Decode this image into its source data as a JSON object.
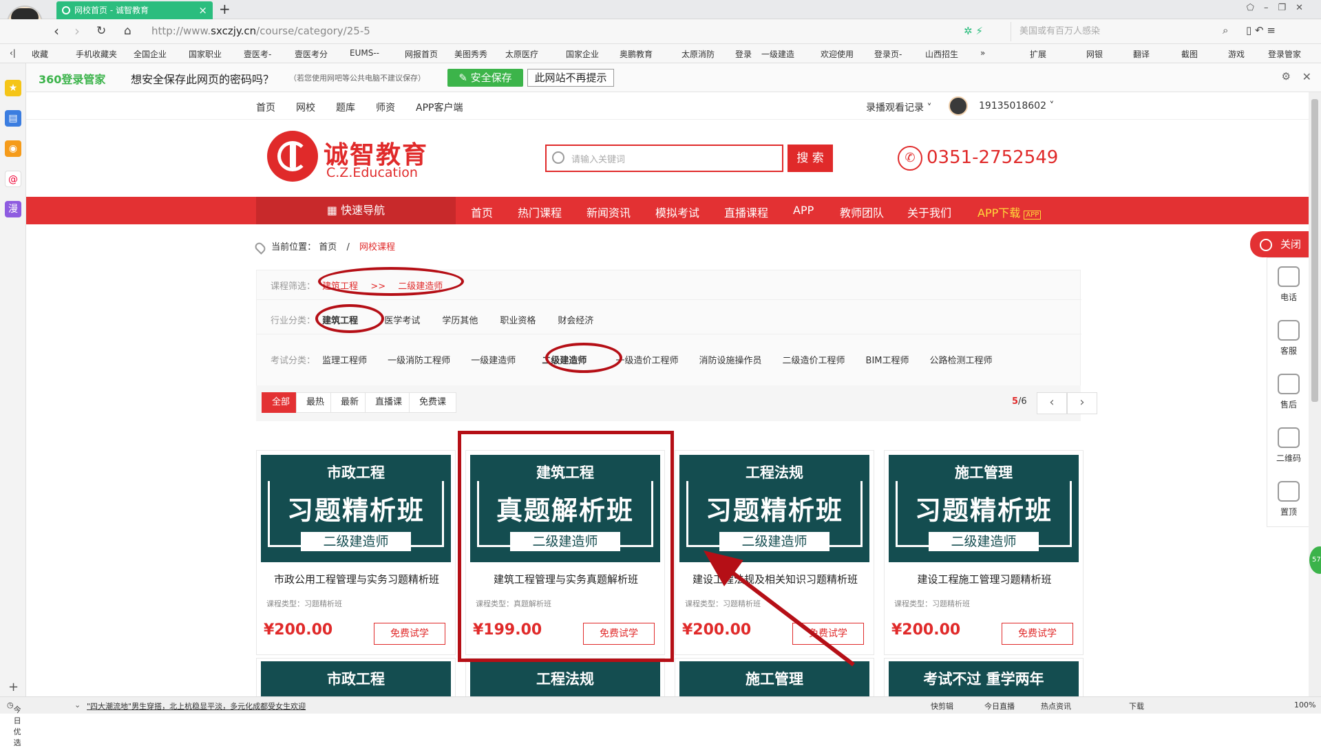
{
  "browser": {
    "tab_title": "网校首页 - 诚智教育",
    "new_tab": "+",
    "url_prefix": "http://www.",
    "url_domain": "sxczjy.cn",
    "url_path": "/course/category/25-5",
    "search_placeholder": "美国或有百万人感染",
    "bookmarks": [
      "收藏",
      "手机收藏夹",
      "全国企业",
      "国家职业",
      "壹医考-",
      "壹医考分",
      "EUMS--",
      "网报首页",
      "美图秀秀",
      "太原医疗",
      "国家企业",
      "奥鹏教育",
      "太原消防",
      "登录",
      "一级建造",
      "欢迎使用",
      "登录页-",
      "山西招生"
    ],
    "bookmarks_more": "»",
    "right_tools": [
      "扩展",
      "网银",
      "翻译",
      "截图",
      "游戏",
      "登录管家"
    ]
  },
  "password_bar": {
    "logo": "360登录管家",
    "question": "想安全保存此网页的密码吗？",
    "note": "（若您使用网吧等公共电脑不建议保存）",
    "save_label": "安全保存",
    "no_label": "此网站不再提示"
  },
  "site": {
    "topnav": [
      "首页",
      "网校",
      "题库",
      "师资",
      "APP客户端"
    ],
    "history": "录播观看记录",
    "username": "19135018602",
    "logo_text": "诚智教育",
    "logo_sub": "C.Z.Education",
    "search_placeholder": "请输入关键词",
    "search_btn": "搜 索",
    "phone": "0351-2752549",
    "quick_nav": "快速导航",
    "mainnav": [
      "首页",
      "热门课程",
      "新闻资讯",
      "模拟考试",
      "直播课程",
      "APP",
      "教师团队",
      "关于我们"
    ],
    "app_download": "APP下载",
    "breadcrumb": {
      "label": "当前位置：",
      "home": "首页",
      "sep": "/",
      "current": "网校课程"
    },
    "filter": {
      "course_label": "课程筛选：",
      "course_path_a": "建筑工程",
      "course_path_sep": ">>",
      "course_path_b": "二级建造师",
      "industry_label": "行业分类：",
      "industry_selected": "建筑工程",
      "industries": [
        "医学考试",
        "学历其他",
        "职业资格",
        "财会经济"
      ],
      "exam_label": "考试分类：",
      "exams_before": [
        "监理工程师",
        "一级消防工程师",
        "一级建造师"
      ],
      "exam_selected": "二级建造师",
      "exams_after": [
        "一级造价工程师",
        "消防设施操作员",
        "二级造价工程师",
        "BIM工程师",
        "公路检测工程师"
      ]
    },
    "sort_tabs": [
      "全部",
      "最热",
      "最新",
      "直播课",
      "免费课"
    ],
    "pager": {
      "current": "5",
      "total": "/6",
      "prev": "‹",
      "next": "›"
    },
    "courses": [
      {
        "top": "市政工程",
        "main": "习题精析班",
        "level": "二级建造师",
        "title": "市政公用工程管理与实务习题精析班",
        "type": "课程类型：习题精析班",
        "price": "¥200.00",
        "btn": "免费试学"
      },
      {
        "top": "建筑工程",
        "main": "真题解析班",
        "level": "二级建造师",
        "title": "建筑工程管理与实务真题解析班",
        "type": "课程类型：真题解析班",
        "price": "¥199.00",
        "btn": "免费试学"
      },
      {
        "top": "工程法规",
        "main": "习题精析班",
        "level": "二级建造师",
        "title": "建设工程法规及相关知识习题精析班",
        "type": "课程类型：习题精析班",
        "price": "¥200.00",
        "btn": "免费试学"
      },
      {
        "top": "施工管理",
        "main": "习题精析班",
        "level": "二级建造师",
        "title": "建设工程施工管理习题精析班",
        "type": "课程类型：习题精析班",
        "price": "¥200.00",
        "btn": "免费试学"
      }
    ],
    "courses_row2": [
      "市政工程",
      "工程法规",
      "施工管理",
      "考试不过 重学两年"
    ],
    "right_panel": {
      "close": "关闭",
      "items": [
        "电话",
        "客服",
        "售后",
        "二维码",
        "置顶"
      ]
    }
  },
  "statusbar": {
    "left": "今日优选",
    "news": "\"四大潮流地\"男生穿搭，北上杭稳显平淡，多元化成都受女生欢迎",
    "right": [
      "快剪辑",
      "今日直播",
      "热点资讯",
      "下载",
      "100%"
    ]
  }
}
